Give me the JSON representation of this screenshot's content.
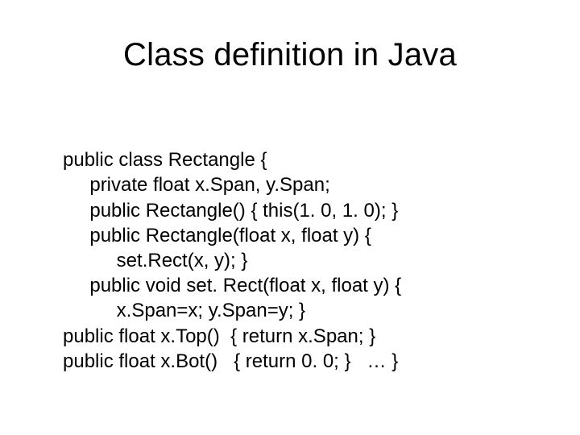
{
  "title": "Class definition in Java",
  "code": {
    "l1": "public class Rectangle {",
    "l2": "     private float x.Span, y.Span;",
    "l3": "     public Rectangle() { this(1. 0, 1. 0); }",
    "l4": "     public Rectangle(float x, float y) {",
    "l5": "          set.Rect(x, y); }",
    "l6": "     public void set. Rect(float x, float y) {",
    "l7": "          x.Span=x; y.Span=y; }",
    "l8": "public float x.Top()  { return x.Span; }",
    "l9": "public float x.Bot()   { return 0. 0; }   … }"
  }
}
